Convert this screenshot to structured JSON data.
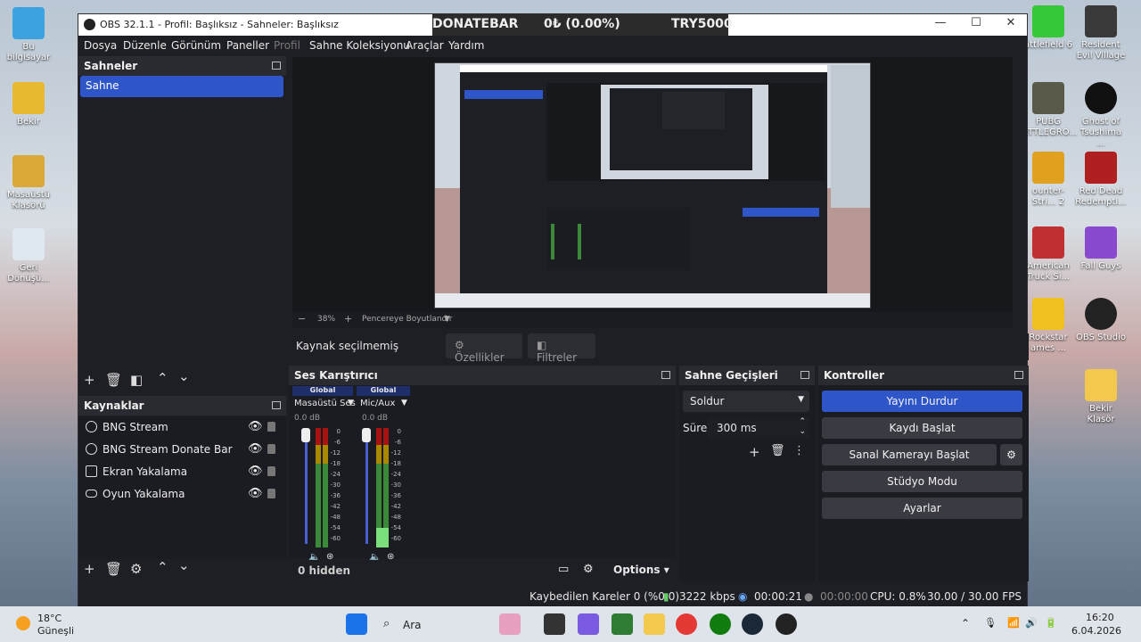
{
  "window": {
    "title": "OBS 32.1.1 - Profil: Başlıksız - Sahneler: Başlıksız",
    "minimize": "—",
    "maximize": "☐",
    "close": "✕"
  },
  "donate_bar": {
    "name": "DONATEBAR",
    "value": "0₺ (0.00%)",
    "goal": "TRY5000"
  },
  "menu": [
    "Dosya",
    "Düzenle",
    "Görünüm",
    "Paneller",
    "Profil",
    "Sahne Koleksiyonu",
    "Araçlar",
    "Yardım"
  ],
  "scenes": {
    "title": "Sahneler",
    "items": [
      "Sahne"
    ]
  },
  "sources": {
    "title": "Kaynaklar",
    "items": [
      {
        "label": "BNG Stream",
        "icon": "globe-icon"
      },
      {
        "label": "BNG Stream Donate Bar",
        "icon": "globe-icon"
      },
      {
        "label": "Ekran Yakalama",
        "icon": "monitor-icon"
      },
      {
        "label": "Oyun Yakalama",
        "icon": "gamepad-icon"
      }
    ]
  },
  "preview_bar": {
    "minus": "−",
    "zoom": "38%",
    "plus": "+",
    "fit": "Pencereye Boyutlandır"
  },
  "context": {
    "no_source": "Kaynak seçilmemiş",
    "properties": "Özellikler",
    "filters": "Filtreler"
  },
  "mixer": {
    "title": "Ses Karıştırıcı",
    "channels": [
      {
        "badge": "Global",
        "name": "Masaüstü Ses",
        "db": "0.0 dB"
      },
      {
        "badge": "Global",
        "name": "Mic/Aux",
        "db": "0.0 dB"
      }
    ],
    "scale": [
      "0",
      "-6",
      "-12",
      "-18",
      "-24",
      "-30",
      "-36",
      "-42",
      "-48",
      "-54",
      "-60"
    ],
    "hidden": "0 hidden",
    "options": "Options"
  },
  "transitions": {
    "title": "Sahne Geçişleri",
    "selected": "Soldur",
    "duration_label": "Süre",
    "duration_value": "300 ms"
  },
  "controls": {
    "title": "Kontroller",
    "buttons": [
      "Yayını Durdur",
      "Kaydı Başlat",
      "Sanal Kamerayı Başlat",
      "Stüdyo Modu",
      "Ayarlar"
    ]
  },
  "status": {
    "dropped": "Kaybedilen Kareler 0 (%0.0)",
    "bitrate": "3222 kbps",
    "stream_time": "00:00:21",
    "rec_time": "00:00:00",
    "cpu": "CPU: 0.8%",
    "fps": "30.00 / 30.00 FPS"
  },
  "desktop_left": [
    "Bu bilgisayar",
    "Bekir",
    "Masaüstü Klasörü",
    "Geri Dönüşü..."
  ],
  "desktop_right": [
    [
      "attlefield 6",
      "Resident Evil Village"
    ],
    [
      "PUBG ATTLEGRO...",
      "Ghost of Tsushima ..."
    ],
    [
      "ounter-Stri... 2",
      "Red Dead Redempti..."
    ],
    [
      "American Truck Si...",
      "Fall Guys"
    ],
    [
      "Rockstar ames ...",
      "OBS Studio"
    ],
    [
      "",
      "Bekir Klasör"
    ]
  ],
  "taskbar": {
    "weather_temp": "18°C",
    "weather_desc": "Güneşli",
    "search": "Ara",
    "time": "16:20",
    "date": "6.04.2026"
  },
  "colors": {
    "accent": "#2f56c8",
    "panel": "#1e1f25",
    "header": "#2a2b31"
  }
}
